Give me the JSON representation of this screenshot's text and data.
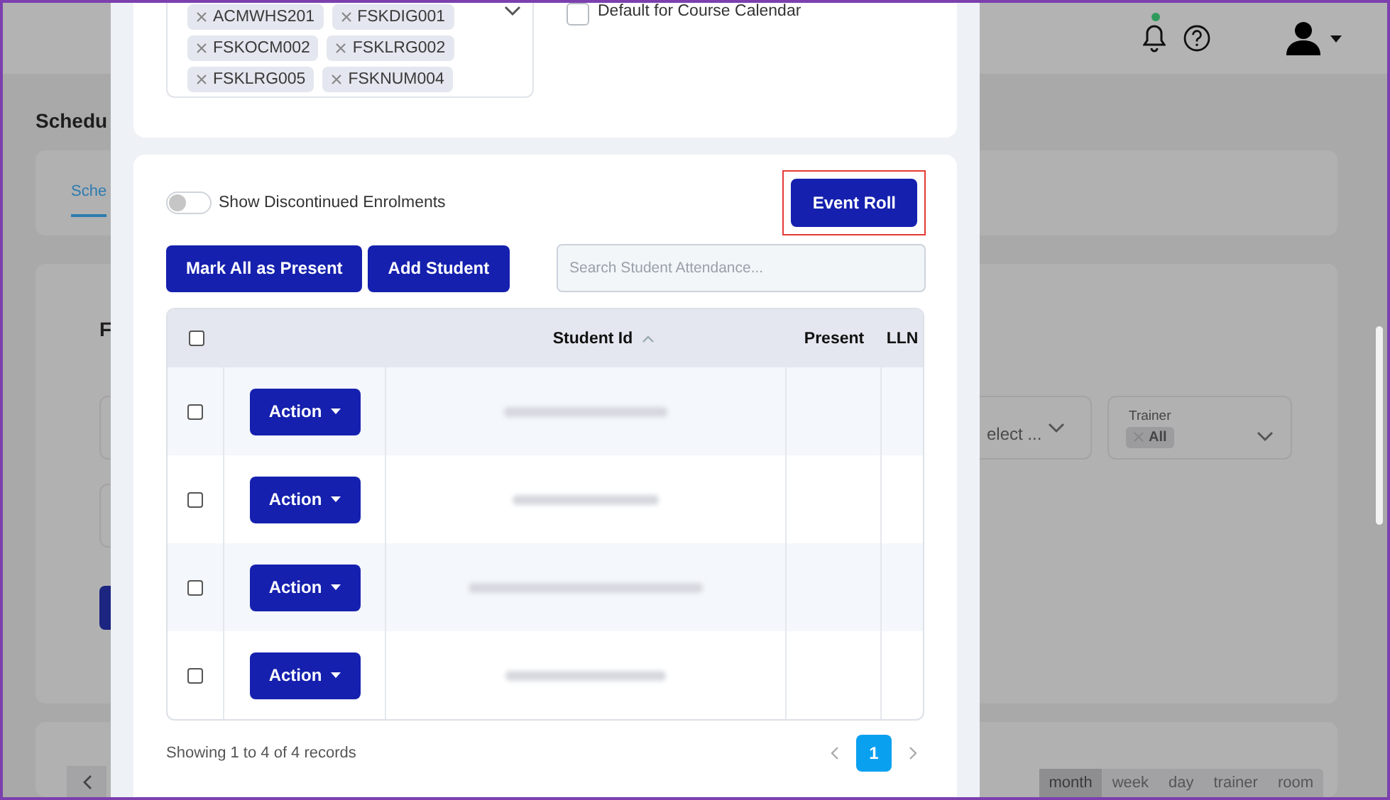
{
  "header": {
    "has_notifications": true
  },
  "background": {
    "title": "Schedu",
    "tab": {
      "label": "Sche",
      "selected": true
    },
    "filter_heading": "F",
    "filters": [
      {
        "kind": "select",
        "placeholder": "elect ..."
      },
      {
        "kind": "chips",
        "label": "Trainer",
        "chips": [
          "All"
        ]
      }
    ],
    "views": [
      {
        "label": "month",
        "selected": true
      },
      {
        "label": "week",
        "selected": false
      },
      {
        "label": "day",
        "selected": false
      },
      {
        "label": "trainer",
        "selected": false
      },
      {
        "label": "room",
        "selected": false
      }
    ]
  },
  "modal": {
    "course_chips": [
      "ACMWHS201",
      "FSKDIG001",
      "FSKOCM002",
      "FSKLRG002",
      "FSKLRG005",
      "FSKNUM004"
    ],
    "default_checkbox": {
      "label": "Default for Course Calendar",
      "checked": false
    },
    "discontinued_toggle": {
      "label": "Show Discontinued Enrolments",
      "on": false
    },
    "event_roll": {
      "label": "Event Roll",
      "highlighted": true
    },
    "buttons": [
      "Mark All as Present",
      "Add Student"
    ],
    "search": {
      "placeholder": "Search Student Attendance..."
    },
    "table": {
      "all_selected": false,
      "columns": [
        {
          "label": "Student Id",
          "sorted": true
        },
        {
          "label": "Present"
        },
        {
          "label": "LLN"
        }
      ],
      "rows": [
        {
          "selected": false,
          "action": "Action"
        },
        {
          "selected": false,
          "action": "Action"
        },
        {
          "selected": false,
          "action": "Action"
        },
        {
          "selected": false,
          "action": "Action"
        }
      ]
    },
    "footer": "Showing 1 to 4 of 4 records",
    "pagination": {
      "pages": [
        {
          "label": "1",
          "selected": true
        }
      ]
    }
  }
}
